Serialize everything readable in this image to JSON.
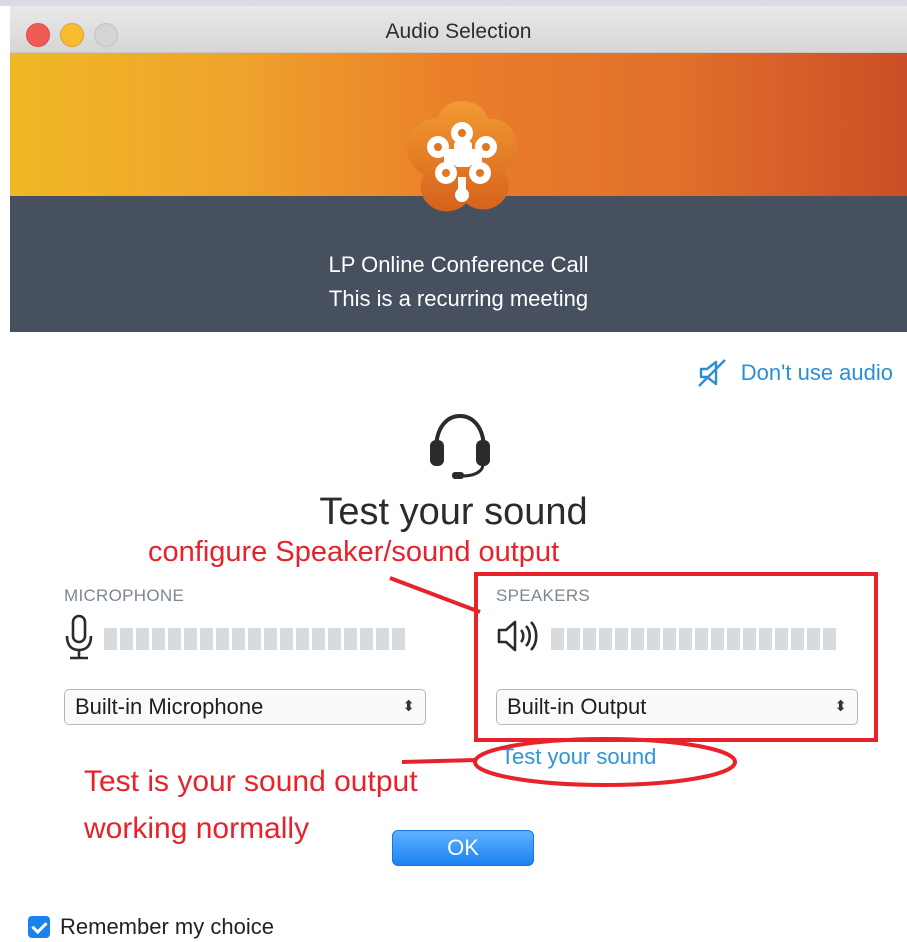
{
  "window": {
    "title": "Audio Selection"
  },
  "meeting": {
    "name": "LP Online Conference Call",
    "subtitle": "This is a recurring meeting"
  },
  "actions": {
    "dont_use_audio": "Don't use audio",
    "ok": "OK",
    "test_link": "Test your sound"
  },
  "test": {
    "heading": "Test your sound"
  },
  "microphone": {
    "label": "MICROPHONE",
    "selected": "Built-in Microphone"
  },
  "speakers": {
    "label": "SPEAKERS",
    "selected": "Built-in Output"
  },
  "remember": {
    "label": "Remember my choice",
    "checked": true
  },
  "annotations": {
    "speaker_note": "configure Speaker/sound output",
    "test_note_line1": "Test is your sound output",
    "test_note_line2": "working normally"
  },
  "colors": {
    "accent_blue": "#2a8fd6",
    "annotation_red": "#e8222a",
    "banner_dark": "#46505e",
    "logo_orange": "#e2771f"
  },
  "icons": {
    "dont_use_audio": "speaker-muted-icon",
    "headset": "headset-icon",
    "microphone": "microphone-icon",
    "speaker": "speaker-icon",
    "logo": "gotomeeting-logo-icon"
  }
}
